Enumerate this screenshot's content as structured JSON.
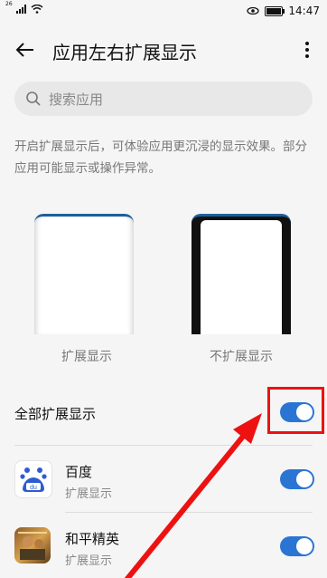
{
  "status": {
    "network": "26",
    "time": "14:47",
    "battery_level": 0.85
  },
  "header": {
    "title": "应用左右扩展显示"
  },
  "search": {
    "placeholder": "搜索应用"
  },
  "description": "开启扩展显示后，可体验应用更沉浸的显示效果。部分应用可能显示或操作异常。",
  "preview": {
    "expand_label": "扩展显示",
    "no_expand_label": "不扩展显示"
  },
  "all_toggle": {
    "label": "全部扩展显示",
    "on": true
  },
  "apps": [
    {
      "name": "百度",
      "status": "扩展显示",
      "on": true,
      "icon": "baidu-icon"
    },
    {
      "name": "和平精英",
      "status": "扩展显示",
      "on": true,
      "icon": "peace-elite-icon"
    }
  ],
  "colors": {
    "accent": "#2a75d3",
    "highlight": "#ee1111"
  }
}
